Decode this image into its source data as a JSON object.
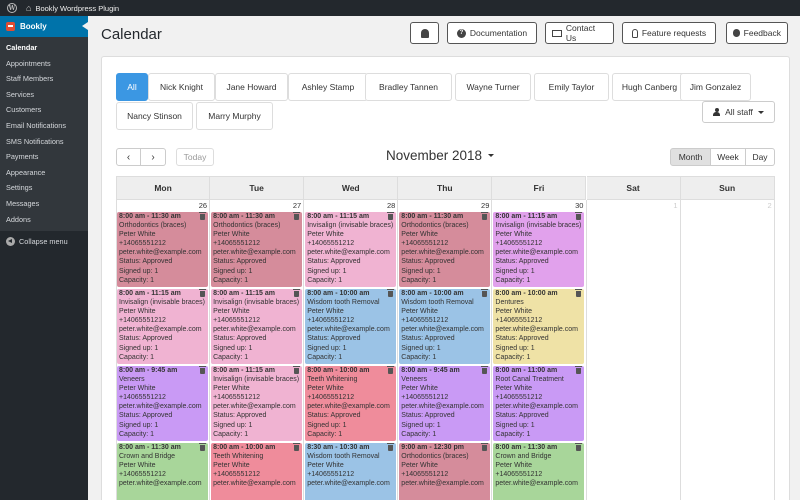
{
  "adminbar": {
    "site_name": "Bookly Wordpress Plugin"
  },
  "sidebar": {
    "plugin_label": "Bookly",
    "items": [
      "Calendar",
      "Appointments",
      "Staff Members",
      "Services",
      "Customers",
      "Email Notifications",
      "SMS Notifications",
      "Payments",
      "Appearance",
      "Settings",
      "Messages",
      "Addons"
    ],
    "collapse_label": "Collapse menu"
  },
  "header": {
    "title": "Calendar",
    "documentation": "Documentation",
    "contact": "Contact Us",
    "feature_requests": "Feature requests",
    "feedback": "Feedback"
  },
  "staff_tabs": [
    "All",
    "Nick Knight",
    "Jane Howard",
    "Ashley Stamp",
    "Bradley Tannen",
    "Wayne Turner",
    "Emily Taylor",
    "Hugh Canberg",
    "Jim Gonzalez",
    "Nancy Stinson",
    "Marry Murphy"
  ],
  "staff_select": "All staff",
  "toolbar": {
    "prev": "‹",
    "next": "›",
    "today": "Today",
    "month_title": "November 2018",
    "views": [
      "Month",
      "Week",
      "Day"
    ]
  },
  "weekdays": [
    "Mon",
    "Tue",
    "Wed",
    "Thu",
    "Fri",
    "Sat",
    "Sun"
  ],
  "day_numbers": [
    "26",
    "27",
    "28",
    "29",
    "30",
    "1",
    "2"
  ],
  "colors": {
    "pink": "#f0b3d2",
    "rose": "#d58c9b",
    "lilac": "#e3b6ee",
    "purple": "#c99af5",
    "blue": "#9bc3e6",
    "yellow": "#efe2a6",
    "green": "#a8d69a",
    "red": "#ef8c9b",
    "orchid": "#e1a1ec"
  },
  "events": [
    [
      {
        "time": "8:00 am - 11:30 am",
        "service": "Orthodontics (braces)",
        "name": "Peter White",
        "phone": "+14065551212",
        "email": "peter.white@example.com",
        "status": "Status: Approved",
        "signed": "Signed up: 1",
        "capacity": "Capacity: 1",
        "color": "rose"
      },
      {
        "time": "8:00 am - 11:15 am",
        "service": "Invisalign (invisable braces)",
        "name": "Peter White",
        "phone": "+14065551212",
        "email": "peter.white@example.com",
        "status": "Status: Approved",
        "signed": "Signed up: 1",
        "capacity": "Capacity: 1",
        "color": "pink"
      },
      {
        "time": "8:00 am - 9:45 am",
        "service": "Veneers",
        "name": "Peter White",
        "phone": "+14065551212",
        "email": "peter.white@example.com",
        "status": "Status: Approved",
        "signed": "Signed up: 1",
        "capacity": "Capacity: 1",
        "color": "purple"
      },
      {
        "time": "8:00 am - 11:30 am",
        "service": "Crown and Bridge",
        "name": "Peter White",
        "phone": "+14065551212",
        "email": "peter.white@example.com",
        "status": "",
        "signed": "",
        "capacity": "",
        "color": "green"
      }
    ],
    [
      {
        "time": "8:00 am - 11:30 am",
        "service": "Orthodontics (braces)",
        "name": "Peter White",
        "phone": "+14065551212",
        "email": "peter.white@example.com",
        "status": "Status: Approved",
        "signed": "Signed up: 1",
        "capacity": "Capacity: 1",
        "color": "rose"
      },
      {
        "time": "8:00 am - 11:15 am",
        "service": "Invisalign (invisable braces)",
        "name": "Peter White",
        "phone": "+14065551212",
        "email": "peter.white@example.com",
        "status": "Status: Approved",
        "signed": "Signed up: 1",
        "capacity": "Capacity: 1",
        "color": "pink"
      },
      {
        "time": "8:00 am - 11:15 am",
        "service": "Invisalign (invisable braces)",
        "name": "Peter White",
        "phone": "+14065551212",
        "email": "peter.white@example.com",
        "status": "Status: Approved",
        "signed": "Signed up: 1",
        "capacity": "Capacity: 1",
        "color": "pink"
      },
      {
        "time": "8:00 am - 10:00 am",
        "service": "Teeth Whitening",
        "name": "Peter White",
        "phone": "+14065551212",
        "email": "peter.white@example.com",
        "status": "",
        "signed": "",
        "capacity": "",
        "color": "red"
      }
    ],
    [
      {
        "time": "8:00 am - 11:15 am",
        "service": "Invisalign (invisable braces)",
        "name": "Peter White",
        "phone": "+14065551212",
        "email": "peter.white@example.com",
        "status": "Status: Approved",
        "signed": "Signed up: 1",
        "capacity": "Capacity: 1",
        "color": "pink"
      },
      {
        "time": "8:00 am - 10:00 am",
        "service": "Wisdom tooth Removal",
        "name": "Peter White",
        "phone": "+14065551212",
        "email": "peter.white@example.com",
        "status": "Status: Approved",
        "signed": "Signed up: 1",
        "capacity": "Capacity: 1",
        "color": "blue"
      },
      {
        "time": "8:00 am - 10:00 am",
        "service": "Teeth Whitening",
        "name": "Peter White",
        "phone": "+14065551212",
        "email": "peter.white@example.com",
        "status": "Status: Approved",
        "signed": "Signed up: 1",
        "capacity": "Capacity: 1",
        "color": "red"
      },
      {
        "time": "8:30 am - 10:30 am",
        "service": "Wisdom tooth Removal",
        "name": "Peter White",
        "phone": "+14065551212",
        "email": "peter.white@example.com",
        "status": "",
        "signed": "",
        "capacity": "",
        "color": "blue"
      }
    ],
    [
      {
        "time": "8:00 am - 11:30 am",
        "service": "Orthodontics (braces)",
        "name": "Peter White",
        "phone": "+14065551212",
        "email": "peter.white@example.com",
        "status": "Status: Approved",
        "signed": "Signed up: 1",
        "capacity": "Capacity: 1",
        "color": "rose"
      },
      {
        "time": "8:00 am - 10:00 am",
        "service": "Wisdom tooth Removal",
        "name": "Peter White",
        "phone": "+14065551212",
        "email": "peter.white@example.com",
        "status": "Status: Approved",
        "signed": "Signed up: 1",
        "capacity": "Capacity: 1",
        "color": "blue"
      },
      {
        "time": "8:00 am - 9:45 am",
        "service": "Veneers",
        "name": "Peter White",
        "phone": "+14065551212",
        "email": "peter.white@example.com",
        "status": "Status: Approved",
        "signed": "Signed up: 1",
        "capacity": "Capacity: 1",
        "color": "purple"
      },
      {
        "time": "9:00 am - 12:30 pm",
        "service": "Orthodontics (braces)",
        "name": "Peter White",
        "phone": "+14065551212",
        "email": "peter.white@example.com",
        "status": "",
        "signed": "",
        "capacity": "",
        "color": "rose"
      }
    ],
    [
      {
        "time": "8:00 am - 11:15 am",
        "service": "Invisalign (invisable braces)",
        "name": "Peter White",
        "phone": "+14065551212",
        "email": "peter.white@example.com",
        "status": "Status: Approved",
        "signed": "Signed up: 1",
        "capacity": "Capacity: 1",
        "color": "orchid"
      },
      {
        "time": "8:00 am - 10:00 am",
        "service": "Dentures",
        "name": "Peter White",
        "phone": "+14065551212",
        "email": "peter.white@example.com",
        "status": "Status: Approved",
        "signed": "Signed up: 1",
        "capacity": "Capacity: 1",
        "color": "yellow"
      },
      {
        "time": "8:00 am - 11:00 am",
        "service": "Root Canal Treatment",
        "name": "Peter White",
        "phone": "+14065551212",
        "email": "peter.white@example.com",
        "status": "Status: Approved",
        "signed": "Signed up: 1",
        "capacity": "Capacity: 1",
        "color": "purple"
      },
      {
        "time": "8:00 am - 11:30 am",
        "service": "Crown and Bridge",
        "name": "Peter White",
        "phone": "+14065551212",
        "email": "peter.white@example.com",
        "status": "",
        "signed": "",
        "capacity": "",
        "color": "green"
      }
    ],
    [],
    []
  ]
}
